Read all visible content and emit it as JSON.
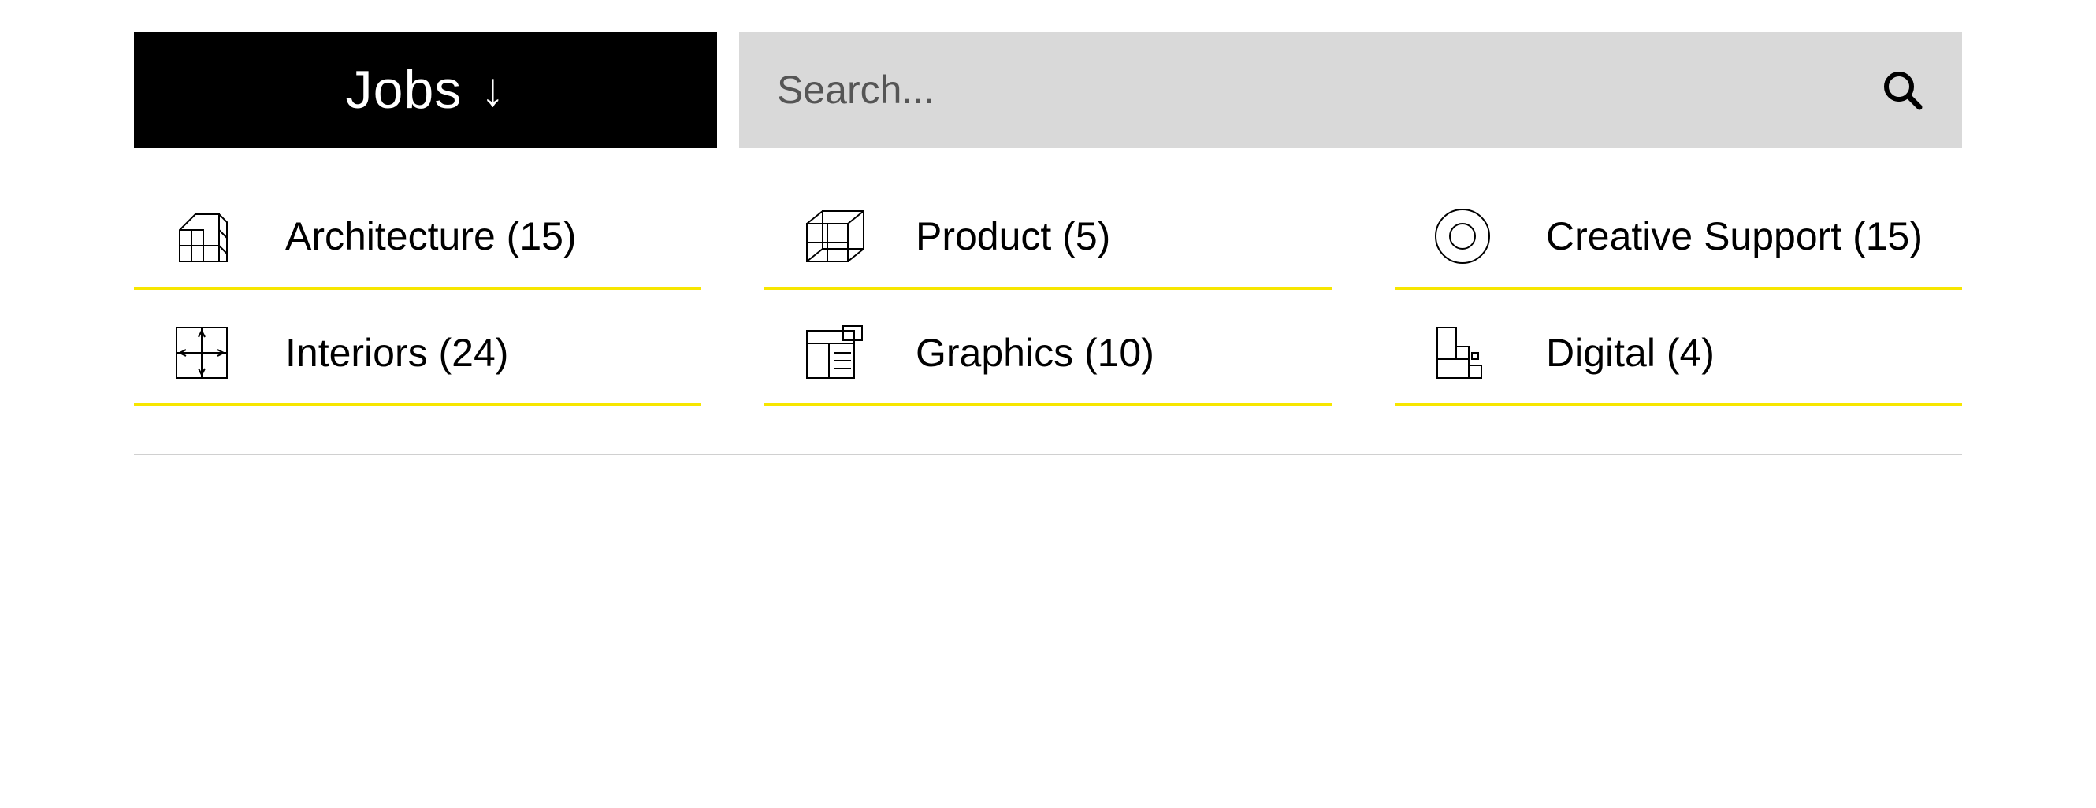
{
  "header": {
    "jobs_label": "Jobs",
    "arrow_glyph": "↓"
  },
  "search": {
    "placeholder": "Search...",
    "value": ""
  },
  "categories": [
    {
      "label": "Architecture (15)",
      "icon": "building-wireframe-icon"
    },
    {
      "label": "Product (5)",
      "icon": "cube-wireframe-icon"
    },
    {
      "label": "Creative Support (15)",
      "icon": "concentric-circles-icon"
    },
    {
      "label": "Interiors (24)",
      "icon": "room-arrows-icon"
    },
    {
      "label": "Graphics (10)",
      "icon": "layout-page-icon"
    },
    {
      "label": "Digital (4)",
      "icon": "modular-blocks-icon"
    }
  ],
  "colors": {
    "accent_yellow": "#f7e600",
    "search_bg": "#d9d9d9",
    "dropdown_bg": "#000000"
  }
}
